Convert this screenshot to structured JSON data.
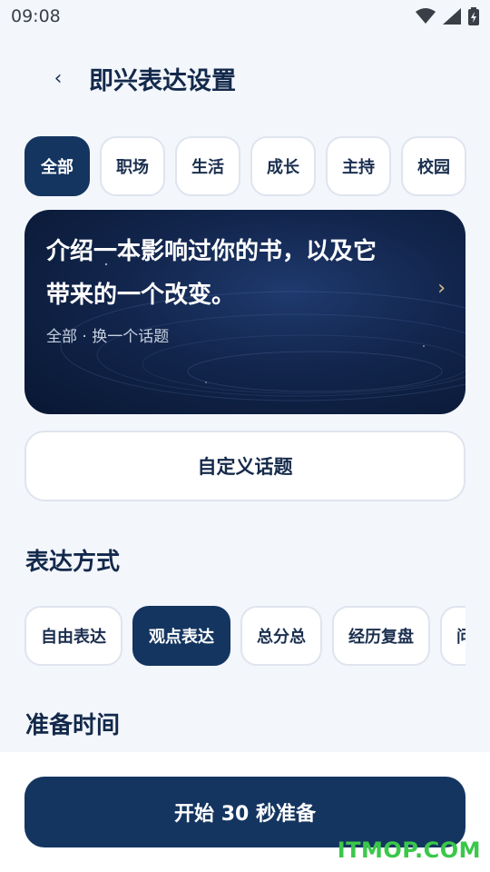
{
  "status_bar": {
    "time": "09:08"
  },
  "header": {
    "back_icon": "‹",
    "title": "即兴表达设置"
  },
  "categories": [
    {
      "label": "全部",
      "active": true
    },
    {
      "label": "职场",
      "active": false
    },
    {
      "label": "生活",
      "active": false
    },
    {
      "label": "成长",
      "active": false
    },
    {
      "label": "主持",
      "active": false
    },
    {
      "label": "校园",
      "active": false
    }
  ],
  "topic_card": {
    "line1": "介绍一本影响过你的书，以及它",
    "line2": "带来的一个改变。",
    "meta": "全部 · 换一个话题",
    "arrow": "›"
  },
  "custom_topic_label": "自定义话题",
  "expression_section": {
    "title": "表达方式",
    "styles": [
      {
        "label": "自由表达",
        "active": false
      },
      {
        "label": "观点表达",
        "active": true
      },
      {
        "label": "总分总",
        "active": false
      },
      {
        "label": "经历复盘",
        "active": false
      },
      {
        "label": "问",
        "active": false
      }
    ]
  },
  "prep_section": {
    "title": "准备时间"
  },
  "start_button_label": "开始 30 秒准备",
  "watermark": "ITMOP.COM",
  "colors": {
    "primary": "#143560",
    "background": "#f3f6fb",
    "accent_arrow": "#d9c28a",
    "watermark": "#3ac84a"
  }
}
